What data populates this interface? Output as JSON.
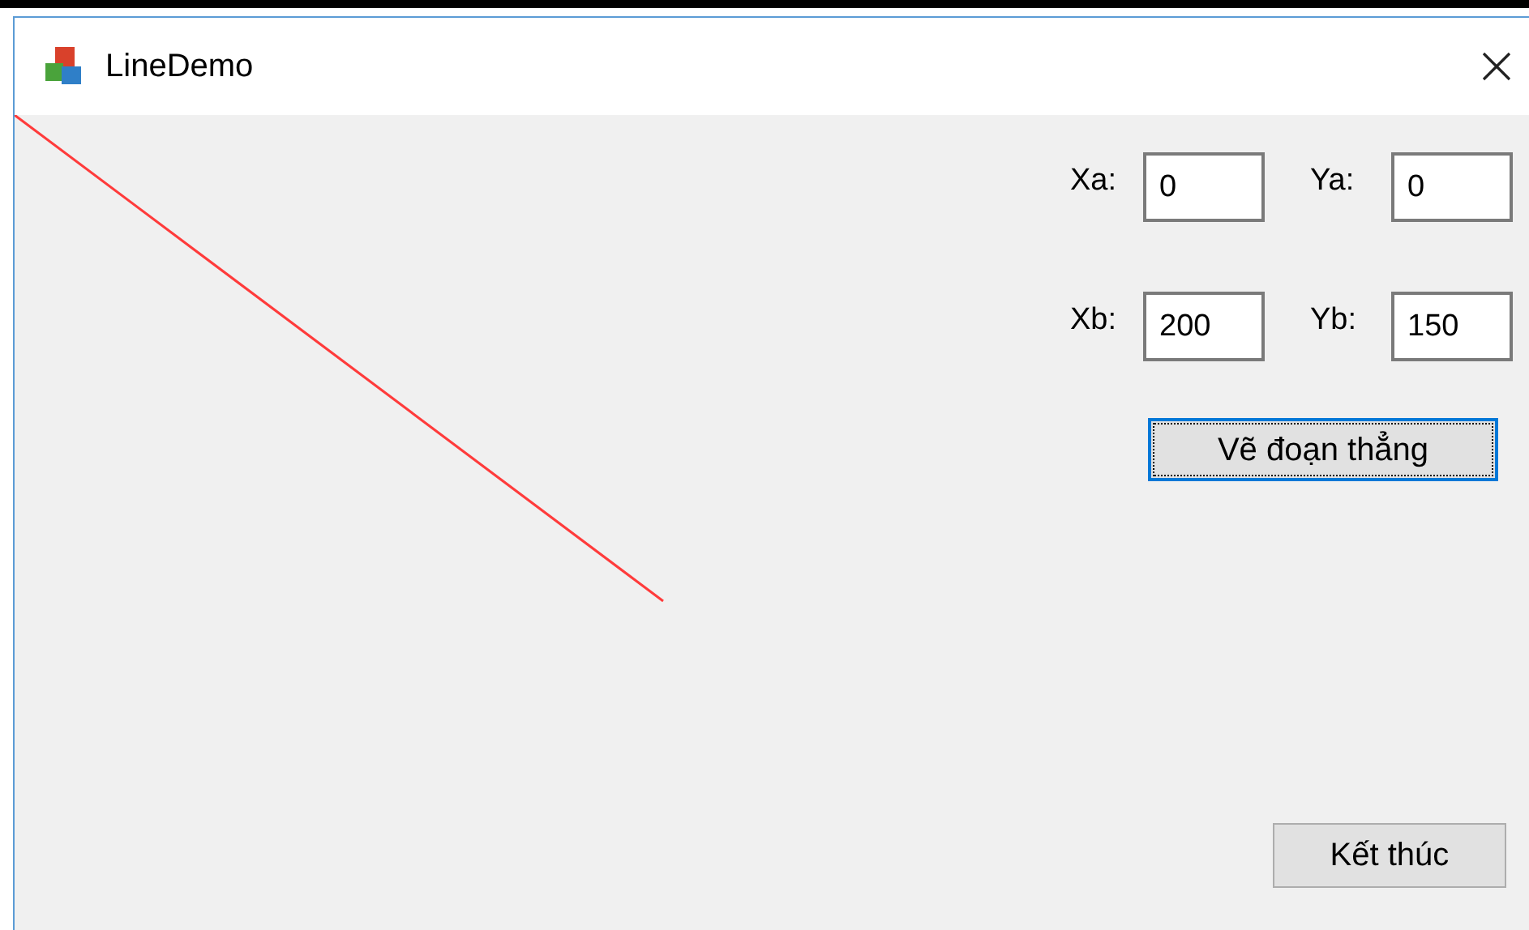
{
  "window": {
    "title": "LineDemo"
  },
  "fields": [
    {
      "label": "Xa:",
      "value": "0"
    },
    {
      "label": "Ya:",
      "value": "0"
    },
    {
      "label": "Xb:",
      "value": "200"
    },
    {
      "label": "Yb:",
      "value": "150"
    }
  ],
  "draw_button": {
    "label": "Vẽ đoạn thẳng",
    "focused": true
  },
  "exit_button": {
    "label": "Kết thúc"
  }
}
